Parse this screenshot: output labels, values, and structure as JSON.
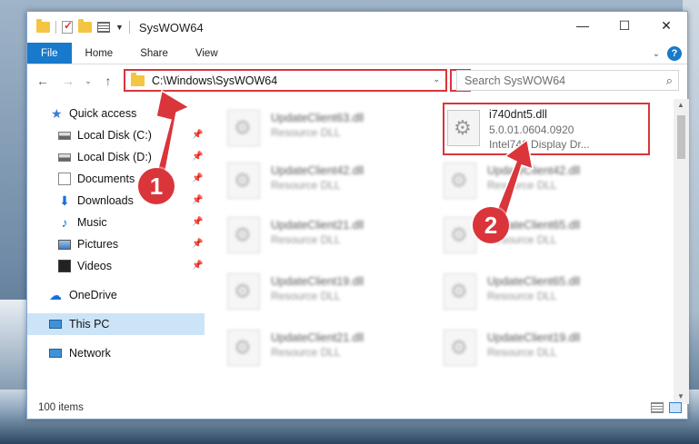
{
  "window": {
    "title": "SysWOW64"
  },
  "titlebar": {
    "minimize_icon": "—",
    "maximize_icon": "☐",
    "close_icon": "✕"
  },
  "ribbon": {
    "tabs": [
      "File",
      "Home",
      "Share",
      "View"
    ],
    "help_icon": "?"
  },
  "address": {
    "path": "C:\\Windows\\SysWOW64",
    "refresh_icon": "↻"
  },
  "search": {
    "placeholder": "Search SysWOW64",
    "icon": "⌕"
  },
  "nav": {
    "items": [
      {
        "label": "Quick access",
        "icon": "star-icon",
        "pinned": false
      },
      {
        "label": "Local Disk (C:)",
        "icon": "drive-icon",
        "pinned": true
      },
      {
        "label": "Local Disk (D:)",
        "icon": "drive-icon",
        "pinned": true
      },
      {
        "label": "Documents",
        "icon": "documents-icon",
        "pinned": true
      },
      {
        "label": "Downloads",
        "icon": "downloads-icon",
        "pinned": true
      },
      {
        "label": "Music",
        "icon": "music-icon",
        "pinned": true
      },
      {
        "label": "Pictures",
        "icon": "pictures-icon",
        "pinned": true
      },
      {
        "label": "Videos",
        "icon": "videos-icon",
        "pinned": true
      },
      {
        "label": "OneDrive",
        "icon": "cloud-icon",
        "pinned": false
      },
      {
        "label": "This PC",
        "icon": "computer-icon",
        "pinned": false,
        "selected": true
      },
      {
        "label": "Network",
        "icon": "network-icon",
        "pinned": false
      }
    ]
  },
  "files": {
    "left_column": [
      {
        "name": "UpdateClient63.dll",
        "type": "Resource DLL"
      },
      {
        "name": "UpdateClient42.dll",
        "type": "Resource DLL"
      },
      {
        "name": "UpdateClient21.dll",
        "type": "Resource DLL"
      },
      {
        "name": "UpdateClient19.dll",
        "type": "Resource DLL"
      },
      {
        "name": "UpdateClient21.dll",
        "type": "Resource DLL"
      }
    ],
    "right_column": [
      {
        "name": "i740dnt5.dll",
        "version": "5.0.01.0604.0920",
        "description": "Intel740 Display Dr..."
      },
      {
        "name": "UpdateClient42.dll",
        "type": "Resource DLL"
      },
      {
        "name": "UpdateClient65.dll",
        "type": "Resource DLL"
      },
      {
        "name": "UpdateClient65.dll",
        "type": "Resource DLL"
      },
      {
        "name": "UpdateClient19.dll",
        "type": "Resource DLL"
      }
    ]
  },
  "status": {
    "item_count": "100 items"
  },
  "annotations": {
    "badge1": "1",
    "badge2": "2",
    "accent": "#d9353b"
  }
}
